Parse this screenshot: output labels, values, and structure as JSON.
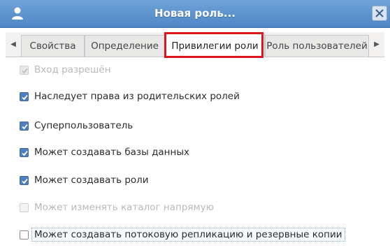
{
  "window": {
    "title": "Новая роль...",
    "icons": {
      "user": "user-icon",
      "close": "close-icon"
    }
  },
  "tabs": [
    {
      "label": "Свойства",
      "active": false
    },
    {
      "label": "Определение",
      "active": false
    },
    {
      "label": "Привилегии роли",
      "active": true
    },
    {
      "label": "Роль пользователей",
      "active": false
    }
  ],
  "tab_arrows": {
    "left": "◀",
    "right": "▶"
  },
  "privileges": [
    {
      "label": "Вход разрешён",
      "checked": true,
      "enabled": false
    },
    {
      "label": "Наследует права из родительских ролей",
      "checked": true,
      "enabled": true
    },
    {
      "label": "Суперпользователь",
      "checked": true,
      "enabled": true
    },
    {
      "label": "Может создавать базы данных",
      "checked": true,
      "enabled": true
    },
    {
      "label": "Может создавать роли",
      "checked": true,
      "enabled": true
    },
    {
      "label": "Может изменять каталог напрямую",
      "checked": false,
      "enabled": false
    },
    {
      "label": "Может создавать потоковую репликацию и резервные копии",
      "checked": false,
      "enabled": true,
      "focused": true
    }
  ],
  "colors": {
    "titlebar": "#5b8fcc",
    "highlight": "#e0141e",
    "checkbox_checked": "#4f7fbf",
    "disabled_text": "#b9b9b9"
  }
}
